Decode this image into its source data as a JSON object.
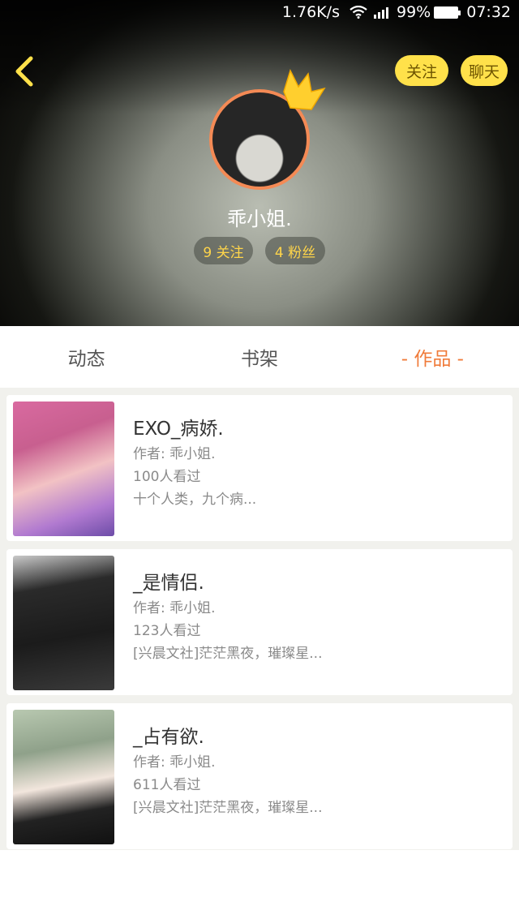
{
  "status_bar": {
    "speed": "1.76K/s",
    "battery": "99%",
    "time": "07:32"
  },
  "header": {
    "follow_label": "关注",
    "chat_label": "聊天",
    "username": "乖小姐.",
    "following_stat": "9 关注",
    "fans_stat": "4 粉丝"
  },
  "tabs": [
    {
      "label": "动态"
    },
    {
      "label": "书架"
    },
    {
      "label": "- 作品 -"
    }
  ],
  "works": [
    {
      "title": "EXO_病娇.",
      "author": "作者: 乖小姐.",
      "views": "100人看过",
      "intro": "十个人类，九个病..."
    },
    {
      "title": "_是情侣.",
      "author": "作者: 乖小姐.",
      "views": "123人看过",
      "intro": "[兴晨文社]茫茫黑夜，璀璨星..."
    },
    {
      "title": "_占有欲.",
      "author": "作者: 乖小姐.",
      "views": "611人看过",
      "intro": "[兴晨文社]茫茫黑夜，璀璨星..."
    }
  ],
  "colors": {
    "accent_orange": "#f07b3a",
    "button_yellow": "#ffe14a",
    "stat_yellow": "#ffd54a"
  }
}
